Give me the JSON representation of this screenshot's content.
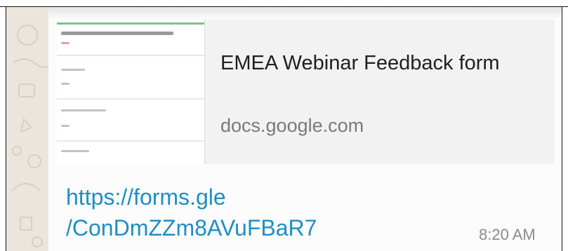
{
  "link_preview": {
    "title": "EMEA Webinar Feedback form",
    "domain": "docs.google.com"
  },
  "message": {
    "url_line1": "https://forms.gle",
    "url_line2": "/ConDmZZm8AVuFBaR7",
    "time": "8:20 AM"
  },
  "colors": {
    "link": "#1f8ec6",
    "wallpaper": "#ece5dd",
    "bubble": "#fcfcfc",
    "preview_background": "#f2f2f2",
    "form_header_bar": "#7bc18c"
  },
  "icons": {
    "wallpaper_doodles": "doodle-pattern-icon"
  }
}
